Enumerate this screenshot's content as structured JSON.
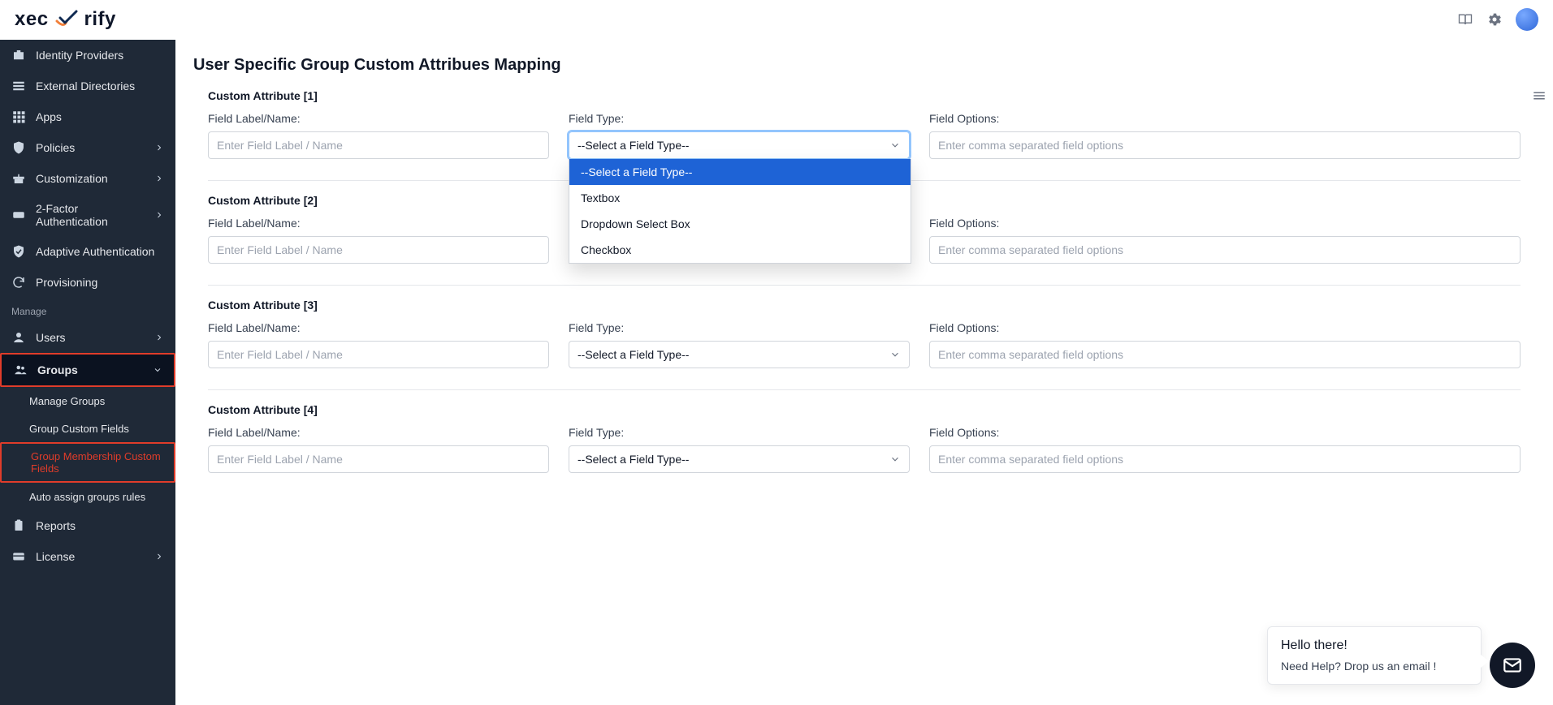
{
  "brand": {
    "name_left": "xec",
    "name_right": "rify"
  },
  "header": {
    "book_icon": "book-icon",
    "gear_icon": "gear-icon",
    "avatar": "avatar"
  },
  "sidebar": {
    "items": [
      {
        "icon": "suitcase",
        "label": "Identity Providers",
        "chev": false
      },
      {
        "icon": "list",
        "label": "External Directories",
        "chev": false
      },
      {
        "icon": "grid",
        "label": "Apps",
        "chev": false
      },
      {
        "icon": "shield",
        "label": "Policies",
        "chev": true
      },
      {
        "icon": "gift",
        "label": "Customization",
        "chev": true
      },
      {
        "icon": "otp",
        "label": "2-Factor Authentication",
        "chev": true
      },
      {
        "icon": "shield-check",
        "label": "Adaptive Authentication",
        "chev": false
      },
      {
        "icon": "sync",
        "label": "Provisioning",
        "chev": false
      }
    ],
    "section": "Manage",
    "users": {
      "label": "Users",
      "chev": true
    },
    "groups": {
      "label": "Groups",
      "expanded": true,
      "subitems": [
        {
          "label": "Manage Groups"
        },
        {
          "label": "Group Custom Fields"
        },
        {
          "label": "Group Membership Custom Fields",
          "active": true
        },
        {
          "label": "Auto assign groups rules"
        }
      ]
    },
    "reports": {
      "label": "Reports"
    },
    "license": {
      "label": "License",
      "chev": true
    }
  },
  "page": {
    "title": "User Specific Group Custom Attribues Mapping",
    "labels": {
      "name": "Field Label/Name:",
      "type": "Field Type:",
      "options": "Field Options:"
    },
    "placeholders": {
      "name": "Enter Field Label / Name",
      "type": "--Select a Field Type--",
      "options": "Enter comma separated field options"
    },
    "attributes": [
      {
        "title": "Custom Attribute [1]"
      },
      {
        "title": "Custom Attribute [2]"
      },
      {
        "title": "Custom Attribute [3]"
      },
      {
        "title": "Custom Attribute [4]"
      }
    ],
    "dropdown": {
      "options": [
        "--Select a Field Type--",
        "Textbox",
        "Dropdown Select Box",
        "Checkbox"
      ],
      "selected_index": 0
    }
  },
  "chat": {
    "hello": "Hello there!",
    "line2": "Need Help? Drop us an email !"
  }
}
